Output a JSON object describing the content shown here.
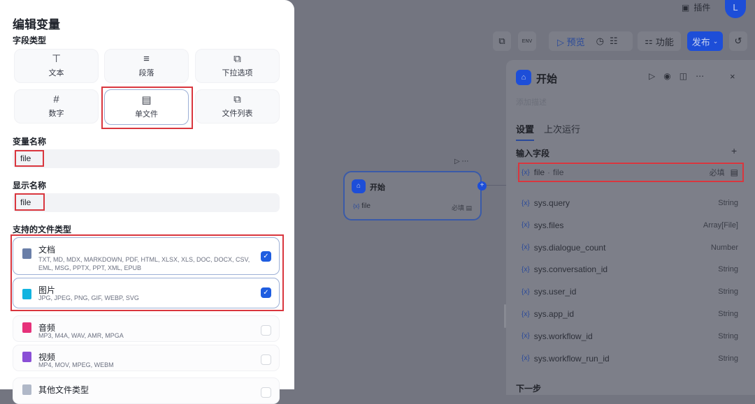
{
  "topbar": {
    "plugins_label": "插件",
    "avatar_letter": "L"
  },
  "toolbar": {
    "env_label": "ENV",
    "preview_label": "预览",
    "features_label": "功能",
    "publish_label": "发布"
  },
  "canvas_node": {
    "title": "开始",
    "field": "file",
    "required": "必填"
  },
  "panel": {
    "title": "开始",
    "description_placeholder": "添加描述",
    "tabs": [
      "设置",
      "上次运行"
    ],
    "section_title": "输入字段",
    "next_step": "下一步",
    "input_field": {
      "name": "file",
      "label": "file",
      "required": "必填"
    },
    "variables": [
      {
        "name": "sys.query",
        "type": "String"
      },
      {
        "name": "sys.files",
        "type": "Array[File]"
      },
      {
        "name": "sys.dialogue_count",
        "type": "Number"
      },
      {
        "name": "sys.conversation_id",
        "type": "String"
      },
      {
        "name": "sys.user_id",
        "type": "String"
      },
      {
        "name": "sys.app_id",
        "type": "String"
      },
      {
        "name": "sys.workflow_id",
        "type": "String"
      },
      {
        "name": "sys.workflow_run_id",
        "type": "String"
      }
    ],
    "var_prefix": "{x}"
  },
  "modal": {
    "title": "编辑变量",
    "field_type_label": "字段类型",
    "field_types": [
      {
        "label": "文本"
      },
      {
        "label": "段落"
      },
      {
        "label": "下拉选项"
      },
      {
        "label": "数字"
      },
      {
        "label": "单文件",
        "selected": true
      },
      {
        "label": "文件列表"
      }
    ],
    "var_name_label": "变量名称",
    "var_name_value": "file",
    "display_name_label": "显示名称",
    "display_name_value": "file",
    "file_types_label": "支持的文件类型",
    "file_types": [
      {
        "name": "文档",
        "exts": "TXT, MD, MDX, MARKDOWN, PDF, HTML, XLSX, XLS, DOC, DOCX, CSV, EML, MSG, PPTX, PPT, XML, EPUB",
        "checked": true,
        "color": "#6a7fa8"
      },
      {
        "name": "图片",
        "exts": "JPG, JPEG, PNG, GIF, WEBP, SVG",
        "checked": true,
        "color": "#12b4e0"
      },
      {
        "name": "音频",
        "exts": "MP3, M4A, WAV, AMR, MPGA",
        "checked": false,
        "color": "#e6317a"
      },
      {
        "name": "视频",
        "exts": "MP4, MOV, MPEG, WEBM",
        "checked": false,
        "color": "#8a4fd6"
      },
      {
        "name": "其他文件类型",
        "exts": "",
        "checked": false,
        "color": "#b0b8c8"
      }
    ]
  }
}
